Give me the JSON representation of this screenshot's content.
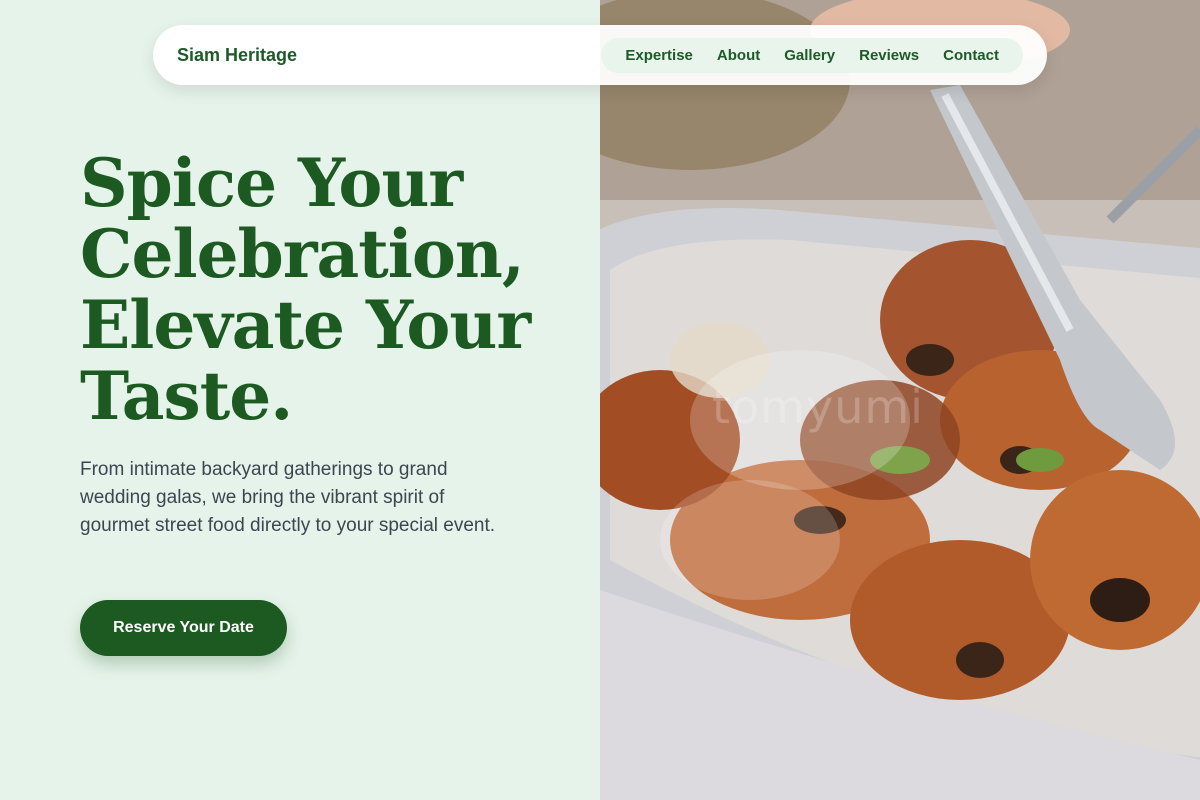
{
  "nav": {
    "brand": "Siam Heritage",
    "links": [
      "Expertise",
      "About",
      "Gallery",
      "Reviews",
      "Contact"
    ]
  },
  "hero": {
    "headline": "Spice Your Celebration, Elevate Your Taste.",
    "subtext": "From intimate backyard gatherings to grand wedding galas, we bring the vibrant spirit of gourmet street food directly to your special event.",
    "cta_label": "Reserve Your Date",
    "image_watermark": "tomyumi"
  },
  "colors": {
    "brand_green": "#1c5a22",
    "panel_bg": "#e6f3ea",
    "nav_pill_bg": "#e9f4ec",
    "body_text": "#3c4650"
  }
}
